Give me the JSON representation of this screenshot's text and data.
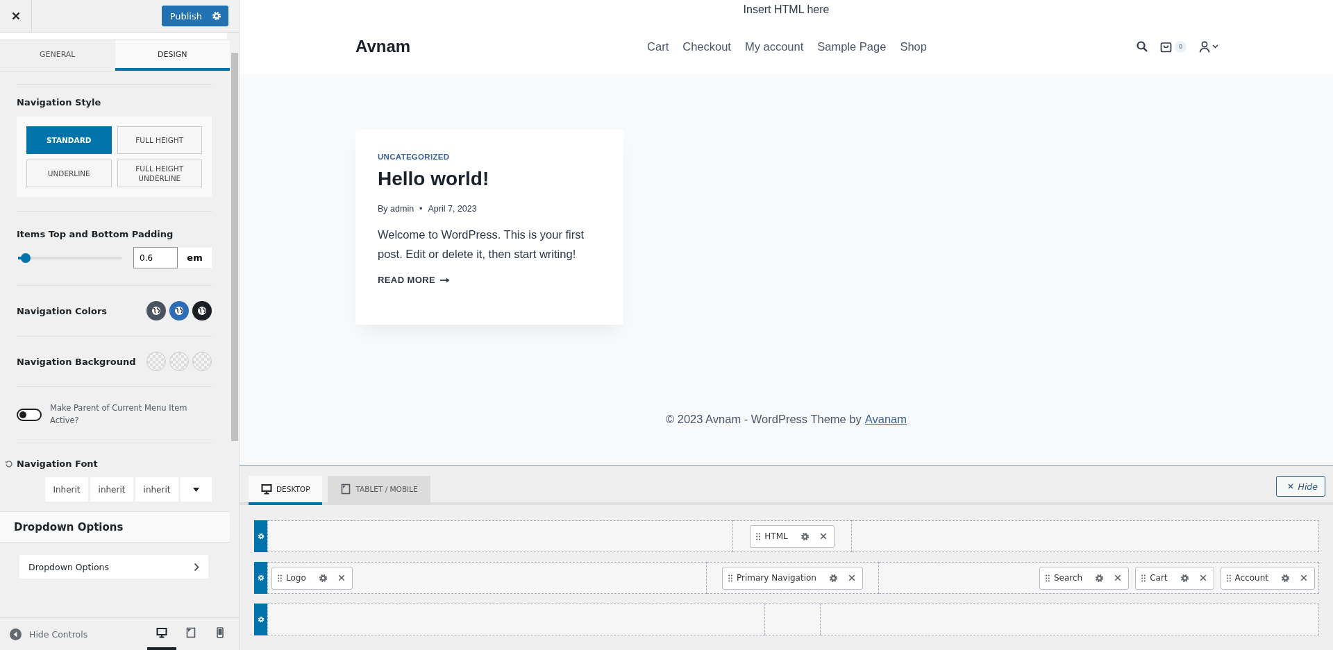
{
  "customizer": {
    "publish": "Publish",
    "tabs": [
      {
        "label": "GENERAL",
        "selected": false
      },
      {
        "label": "DESIGN",
        "selected": true
      }
    ],
    "navigation_style": {
      "label": "Navigation Style",
      "option_rows": [
        [
          {
            "label": "STANDARD",
            "selected": true
          },
          {
            "label": "FULL HEIGHT",
            "selected": false
          }
        ],
        [
          {
            "label": "UNDERLINE",
            "selected": false
          },
          {
            "label": "FULL HEIGHT UNDERLINE",
            "selected": false
          }
        ]
      ]
    },
    "padding": {
      "label": "Items Top and Bottom Padding",
      "level": 0.04,
      "value": "0.6",
      "unit": "em"
    },
    "navigation_colors": {
      "label": "Navigation Colors",
      "swatches": [
        {
          "color": "#4a5361"
        },
        {
          "color": "#2d6db5"
        },
        {
          "color": "#1a1f26"
        }
      ]
    },
    "navigation_background": {
      "label": "Navigation Background"
    },
    "parent_active": {
      "label": "Make Parent of Current Menu Item Active?",
      "on": false
    },
    "navigation_font": {
      "label": "Navigation Font",
      "fields": [
        "Inherit",
        "inherit",
        "inherit"
      ]
    },
    "dropdown": {
      "heading": "Dropdown Options",
      "item": "Dropdown Options"
    },
    "footer": {
      "hide_controls": "Hide Controls",
      "devices": [
        {
          "kind": "desktop",
          "selected": true
        },
        {
          "kind": "tablet",
          "selected": false
        },
        {
          "kind": "mobile",
          "selected": false
        }
      ]
    }
  },
  "preview": {
    "top_html": "Insert HTML here",
    "logo": "Avnam",
    "menu": [
      "Cart",
      "Checkout",
      "My account",
      "Sample Page",
      "Shop"
    ],
    "cart_count": "0",
    "post": {
      "category": "UNCATEGORIZED",
      "title": "Hello world!",
      "author": "By admin",
      "separator": "•",
      "date": "April 7, 2023",
      "excerpt": "Welcome to WordPress. This is your first post. Edit or delete it, then start writing!",
      "read_more": "READ MORE"
    },
    "footer": {
      "text": "© 2023 Avnam - WordPress Theme by",
      "link": "Avanam"
    }
  },
  "builder": {
    "tabs": [
      {
        "label": "DESKTOP",
        "kind": "desktop",
        "selected": true
      },
      {
        "label": "TABLET / MOBILE",
        "kind": "tablet",
        "selected": false
      }
    ],
    "hide": "Hide",
    "rows": [
      {
        "center": [
          "HTML"
        ]
      },
      {
        "left": [
          "Logo"
        ],
        "center": [
          "Primary Navigation"
        ],
        "right": [
          "Search",
          "Cart",
          "Account"
        ]
      },
      {}
    ]
  }
}
